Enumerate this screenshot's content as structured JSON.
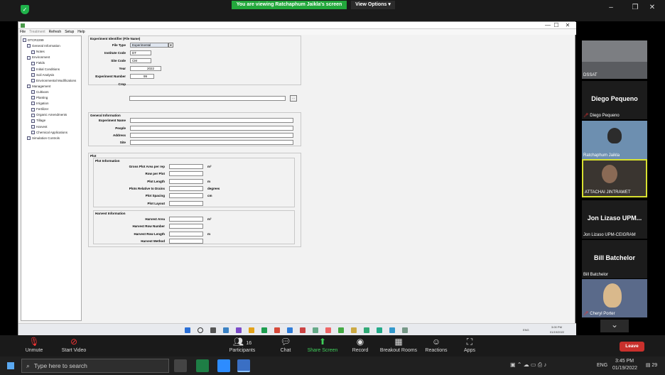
{
  "zoom_top": {
    "banner": "You are viewing Ratchaphum Jaikla's screen",
    "view_options": "View Options ▾",
    "win_min": "‒",
    "win_restore": "❐",
    "win_close": "✕"
  },
  "app": {
    "title_buttons": {
      "min": "—",
      "max": "☐",
      "close": "✕"
    },
    "menu": [
      "File",
      "Treatment",
      "Refresh",
      "Setup",
      "Help"
    ],
    "tree": [
      {
        "label": "DTCR2299",
        "level": 0
      },
      {
        "label": "General Information",
        "level": 1
      },
      {
        "label": "Notes",
        "level": 2
      },
      {
        "label": "Environment",
        "level": 1
      },
      {
        "label": "Fields",
        "level": 2
      },
      {
        "label": "Initial Conditions",
        "level": 2
      },
      {
        "label": "Soil Analysis",
        "level": 2
      },
      {
        "label": "Environmental Modifications",
        "level": 2
      },
      {
        "label": "Management",
        "level": 1
      },
      {
        "label": "Cultivars",
        "level": 2
      },
      {
        "label": "Planting",
        "level": 2
      },
      {
        "label": "Irrigation",
        "level": 2
      },
      {
        "label": "Fertilizer",
        "level": 2
      },
      {
        "label": "Organic Amendments",
        "level": 2
      },
      {
        "label": "Tillage",
        "level": 2
      },
      {
        "label": "Harvest",
        "level": 2
      },
      {
        "label": "Chemical Applications",
        "level": 2
      },
      {
        "label": "Simulation Controls",
        "level": 1
      }
    ],
    "exp_id": {
      "title": "Experiment Identifier (File Name)",
      "file_type_label": "File Type",
      "file_type_value": "Experimental",
      "institute_label": "Institute Code",
      "institute_value": "DT",
      "site_label": "Site Code",
      "site_value": "CM",
      "year_label": "Year",
      "year_value": "2022",
      "expnum_label": "Experiment Number",
      "expnum_value": "99",
      "crop_label": "Crop",
      "crop_value": "",
      "browse": "..."
    },
    "general": {
      "title": "General Information",
      "name_label": "Experiment Name",
      "people_label": "People",
      "address_label": "Address",
      "site_label": "Site"
    },
    "plot": {
      "title": "Plot",
      "info_title": "Plot Information",
      "rows": [
        {
          "label": "Gross Plot Area per rep",
          "unit": "m²"
        },
        {
          "label": "Row per Plot",
          "unit": ""
        },
        {
          "label": "Plot Length",
          "unit": "m"
        },
        {
          "label": "Plots Relative to Drains",
          "unit": "degrees"
        },
        {
          "label": "Plot Spacing",
          "unit": "cm"
        },
        {
          "label": "Plot Layout",
          "unit": ""
        }
      ],
      "harvest_title": "Harvest Information",
      "harvest_rows": [
        {
          "label": "Harvest Area",
          "unit": "m²"
        },
        {
          "label": "Harvest Row Number",
          "unit": ""
        },
        {
          "label": "Harvest Row Length",
          "unit": "m"
        },
        {
          "label": "Harvest Method",
          "unit": ""
        }
      ]
    },
    "tray": {
      "lang": "ENG",
      "time": "3:00 PM",
      "date": "01/19/2022"
    }
  },
  "gallery": {
    "tiles": [
      {
        "name": "DSSAT",
        "big": ""
      },
      {
        "name": "Diego Pequeno",
        "big": "Diego Pequeno"
      },
      {
        "name": "Ratchaphum Jaikla",
        "big": ""
      },
      {
        "name": "ATTACHAI JINTRAWET",
        "big": ""
      },
      {
        "name": "Jon Lizaso UPM-CEIGRAM",
        "big": "Jon Lizaso UPM..."
      },
      {
        "name": "Bill Batchelor",
        "big": "Bill Batchelor"
      },
      {
        "name": "Cheryl Porter",
        "big": ""
      }
    ],
    "more": "⌄"
  },
  "zoom_bar": {
    "unmute": "Unmute",
    "start_video": "Start Video",
    "participants": "Participants",
    "participants_count": "16",
    "chat": "Chat",
    "share_screen": "Share Screen",
    "record": "Record",
    "breakout": "Breakout Rooms",
    "reactions": "Reactions",
    "apps": "Apps",
    "leave": "Leave"
  },
  "taskbar": {
    "search_placeholder": "Type here to search",
    "lang": "ENG",
    "time": "3:45 PM",
    "date": "01/19/2022",
    "notif": "29"
  },
  "colors": {
    "accent_green": "#23a83c",
    "leave_red": "#c9302c",
    "zoom_bg": "#1a1a1a"
  }
}
